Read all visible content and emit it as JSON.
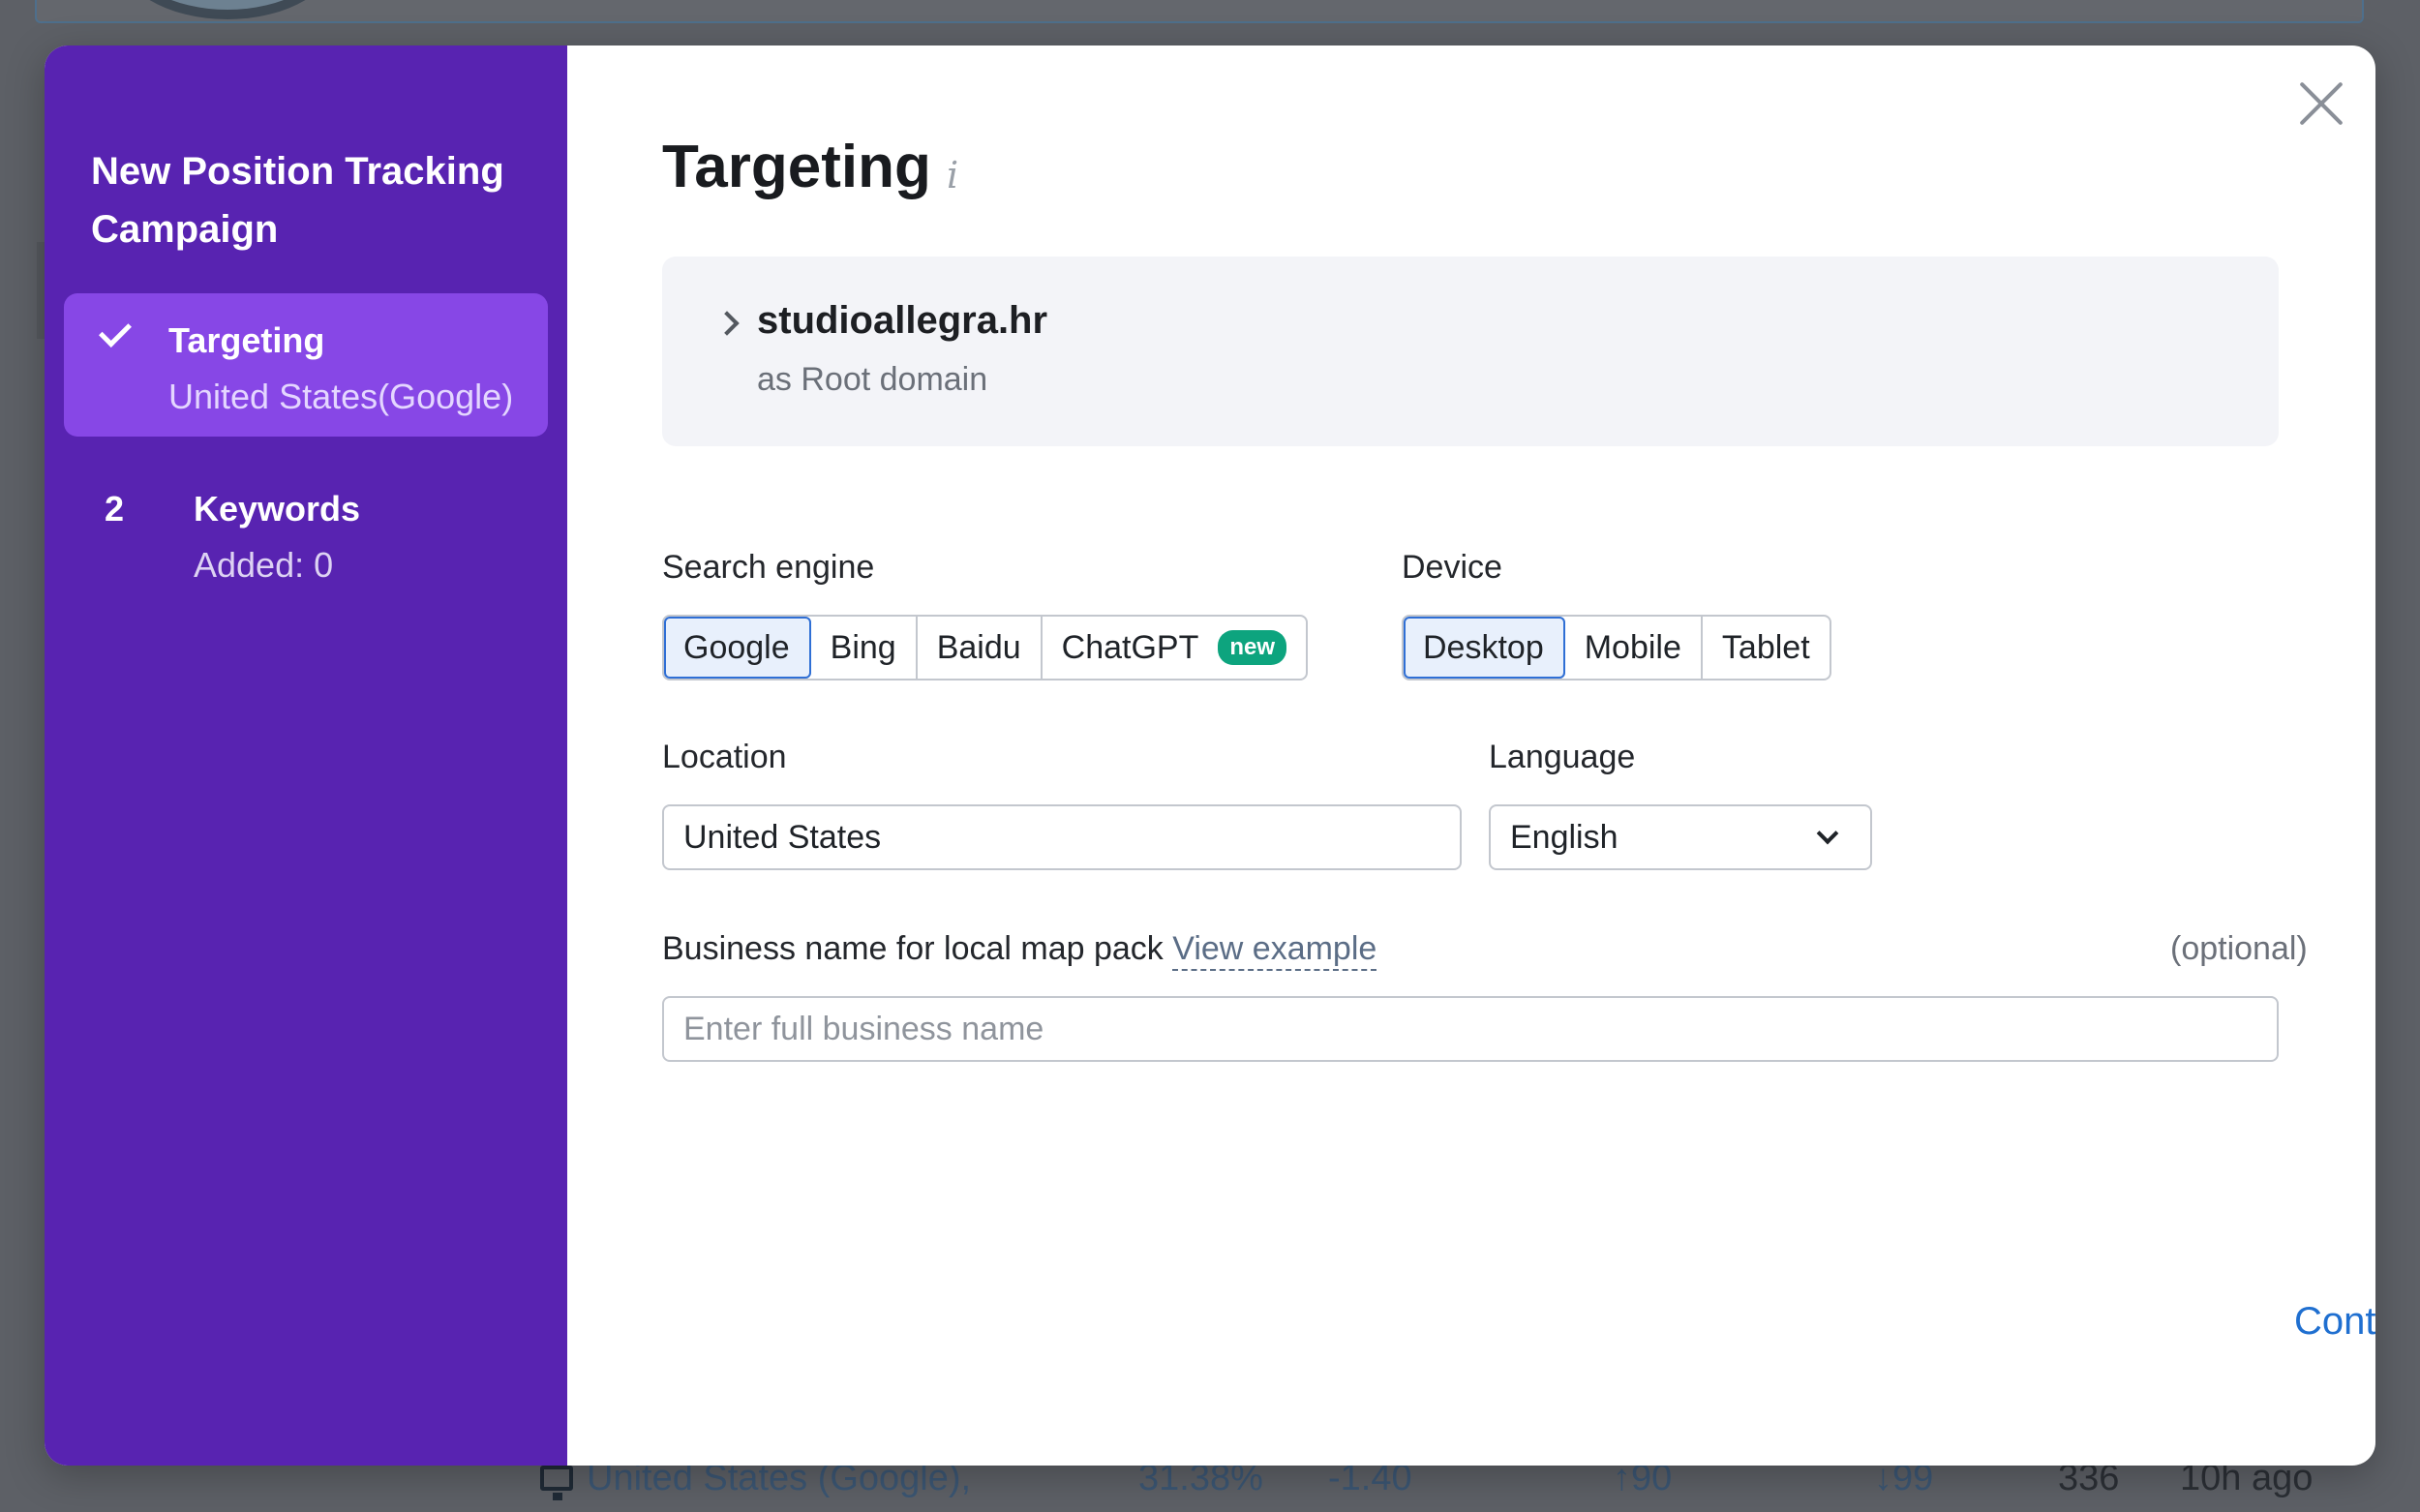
{
  "sidebar": {
    "title": "New Position Tracking Campaign",
    "steps": [
      {
        "marker": "",
        "title": "Targeting",
        "subtitle": "United States(Google)",
        "state": "done"
      },
      {
        "marker": "2",
        "title": "Keywords",
        "subtitle": "Added: 0",
        "state": "pending"
      }
    ]
  },
  "main": {
    "title": "Targeting",
    "info_icon": "info-icon",
    "domain": {
      "name": "studioallegra.hr",
      "scope": "as Root domain"
    },
    "search_engine": {
      "label": "Search engine",
      "options": [
        "Google",
        "Bing",
        "Baidu",
        "ChatGPT"
      ],
      "selected": "Google",
      "new_badge": "new"
    },
    "device": {
      "label": "Device",
      "options": [
        "Desktop",
        "Mobile",
        "Tablet"
      ],
      "selected": "Desktop"
    },
    "location": {
      "label": "Location",
      "value": "United States"
    },
    "language": {
      "label": "Language",
      "value": "English"
    },
    "business": {
      "label": "Business name for local map pack",
      "link": "View example",
      "optional": "(optional)",
      "placeholder": "Enter full business name"
    },
    "continue_label": "Continue To Keywords"
  },
  "background_row": {
    "location": "United States (Google),",
    "visibility": "31.38%",
    "change": "-1.40",
    "up": "↑90",
    "down": "↓99",
    "keywords": "336",
    "updated": "10h ago"
  },
  "colors": {
    "sidebar": "#5823b1",
    "active_step": "#8747e6",
    "accent": "#1f6fd0",
    "badge": "#0da47e"
  }
}
